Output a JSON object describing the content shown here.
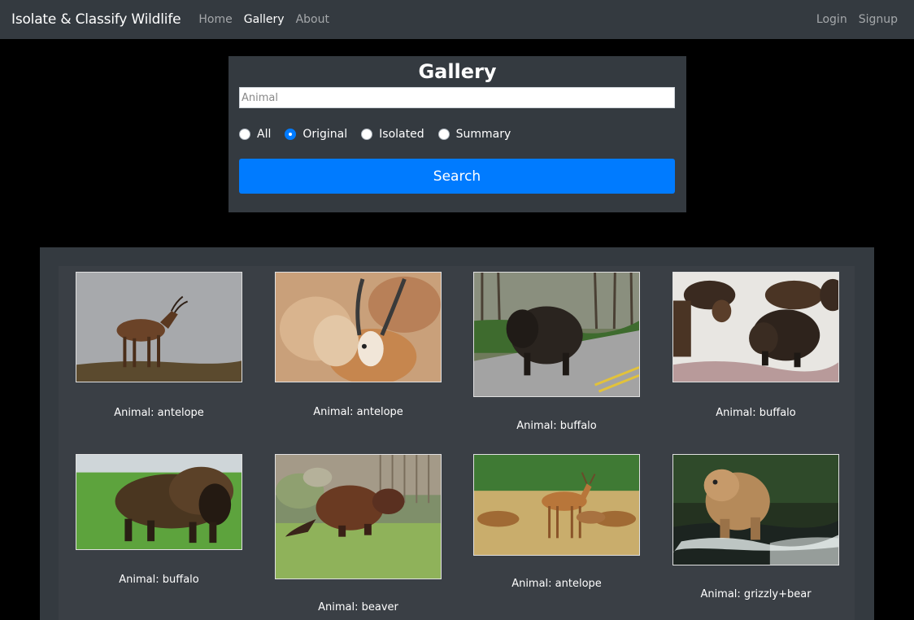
{
  "navbar": {
    "brand": "Isolate & Classify Wildlife",
    "links": [
      "Home",
      "Gallery",
      "About"
    ],
    "right_links": [
      "Login",
      "Signup"
    ]
  },
  "search": {
    "title": "Gallery",
    "placeholder": "Animal",
    "value": "",
    "options": [
      "All",
      "Original",
      "Isolated",
      "Summary"
    ],
    "selected": "Original",
    "button_label": "Search"
  },
  "gallery": {
    "items": [
      {
        "caption": "Animal: antelope"
      },
      {
        "caption": "Animal: antelope"
      },
      {
        "caption": "Animal: buffalo"
      },
      {
        "caption": "Animal: buffalo"
      },
      {
        "caption": "Animal: buffalo"
      },
      {
        "caption": "Animal: beaver"
      },
      {
        "caption": "Animal: antelope"
      },
      {
        "caption": "Animal: grizzly+bear"
      }
    ]
  },
  "colors": {
    "navbar_bg": "#343a40",
    "primary": "#007bff",
    "page_bg": "#000000"
  }
}
